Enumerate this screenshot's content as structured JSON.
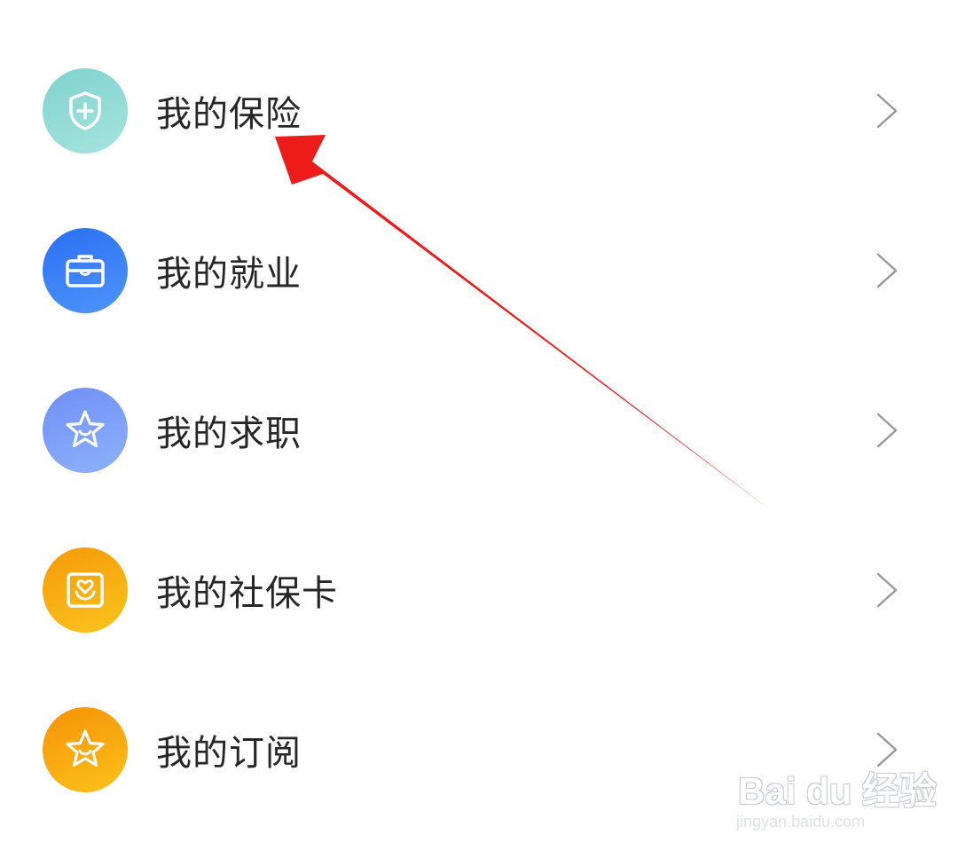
{
  "menu": {
    "items": [
      {
        "label": "我的保险",
        "icon": "shield-plus-icon",
        "color_from": "#7fd3cf",
        "color_to": "#a6e3dd"
      },
      {
        "label": "我的就业",
        "icon": "briefcase-icon",
        "color_from": "#2a6ff2",
        "color_to": "#4f95fb"
      },
      {
        "label": "我的求职",
        "icon": "star-smile-icon",
        "color_from": "#6f8ff5",
        "color_to": "#8eb2fb"
      },
      {
        "label": "我的社保卡",
        "icon": "card-heart-hands-icon",
        "color_from": "#f59a0a",
        "color_to": "#fbc41c"
      },
      {
        "label": "我的订阅",
        "icon": "star-smile-icon",
        "color_from": "#f59207",
        "color_to": "#fbc21a"
      }
    ]
  },
  "annotation": {
    "type": "red-arrow",
    "color": "#ee1b1b",
    "points_to": "我的保险"
  },
  "watermark": {
    "brand": "Bai du 经验",
    "url": "jingyan.baidu.com"
  }
}
